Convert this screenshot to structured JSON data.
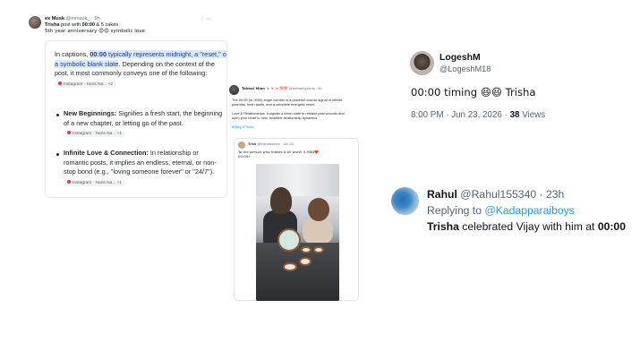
{
  "panel1": {
    "author_name": "ex Musk",
    "author_handle": "@mmask_",
    "author_time": "· 9h",
    "tweet_line1_a": "Trisha",
    "tweet_line1_b": " post with ",
    "tweet_line1_c": "00:00",
    "tweet_line1_d": " & 5 cakes",
    "tweet_line2": "5th year anniversary 😍😍 symbolic love",
    "ai": {
      "para1_a": "In captions, ",
      "para1_b": "00:00",
      "para1_c": " typically represents midnight, a \"reset,\" or a symbolic blank slate",
      "para1_d": ". Depending on the context of the post, it most commonly conveys one of the following:",
      "chip1": "Instagram · Haris Na...",
      "chip1_count": "+2",
      "b1_title": "New Beginnings:",
      "b1_text": " Signifies a fresh start, the beginning of a new chapter, or letting go of the past.",
      "chip2": "Instagram · Haris Na...",
      "chip2_count": "+1",
      "b2_title": "Infinite Love & Connection:",
      "b2_text": " In relationship or romantic posts, it implies an endless, eternal, or non-stop bond (e.g., \"loving someone forever\" or \"24/7\").",
      "chip3": "Instagram · Haris Na...",
      "chip3_count": "+1"
    }
  },
  "panel2": {
    "author": "Talmai Mian 🍬🍬🍬💯💯",
    "handle": "@talmaimysteria",
    "time": "· 9h",
    "line1": "The 00:00 (or 0000) angel number is a powerful cosmic signal of infinite",
    "line2": "potential, fresh starts, and a complete energetic reset.",
    "line3": "Love & Relationships: It signals a clean slate to release past wounds and",
    "line4": "open your heart to new, healthier relationship dynamics.",
    "hashtags": "#Vijay #Trisha",
    "quote_author": "Trish",
    "quote_handle": "@trishtrashers · Jun 23",
    "quote_line1": "To the person who makes it all worth it,HBD❤️",
    "quote_line2": "00:00⚡"
  },
  "panel3": {
    "name": "LogeshM",
    "handle": "@LogeshM18",
    "text": "00:00 timing 😆😆 Trisha",
    "time": "8:00 PM · Jun 23, 2026 · ",
    "views_count": "38",
    "views_label": " Views"
  },
  "panel4": {
    "name": "Rahul",
    "handle": " @Rahul155340 · 23h",
    "replying_prefix": "Replying to ",
    "replying_handle": "@Kadapparaiboys",
    "text_a": "Trisha",
    "text_b": " celebrated Vijay with him at ",
    "text_c": "00:00"
  }
}
